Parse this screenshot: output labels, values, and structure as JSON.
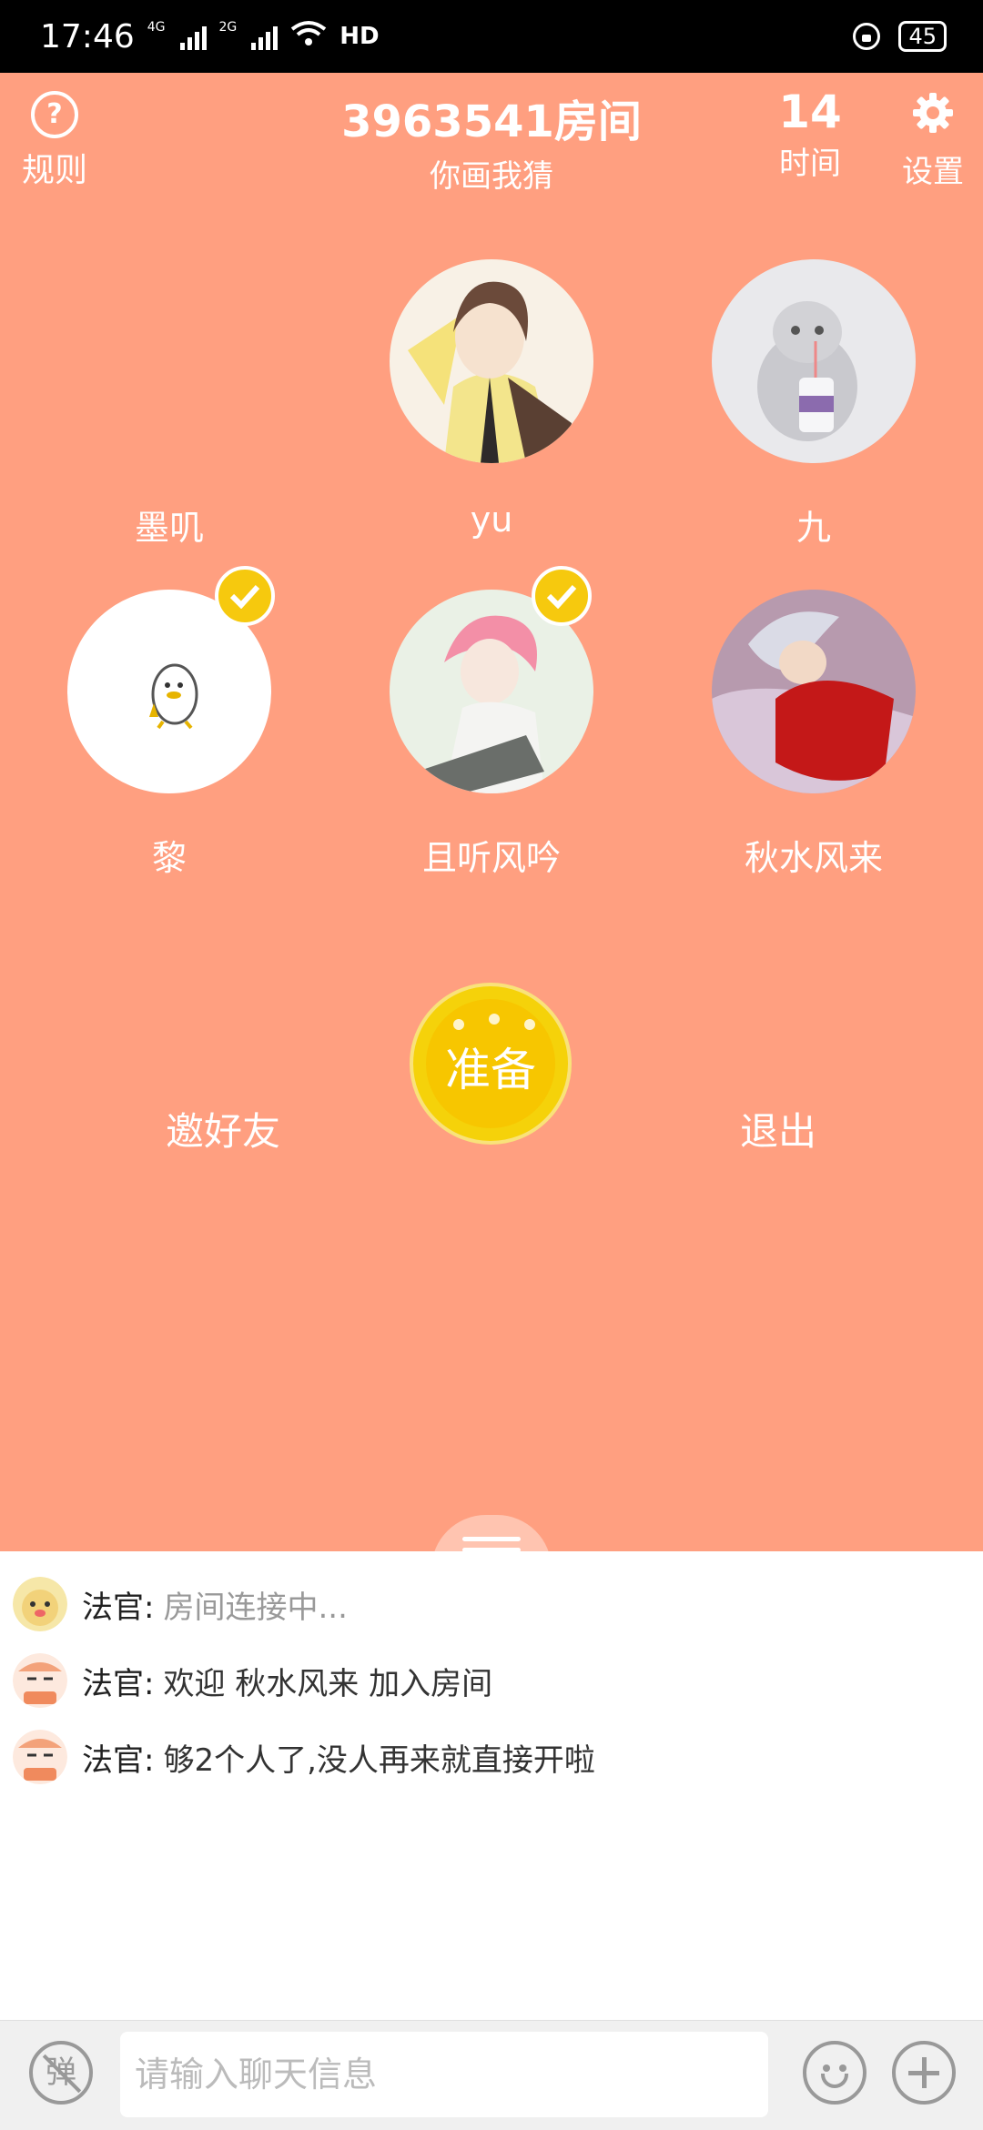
{
  "status_bar": {
    "time": "17:46",
    "net1": "4G",
    "net2": "2G",
    "hd": "HD",
    "battery": "45"
  },
  "header": {
    "rule_label": "规则",
    "room_title": "3963541房间",
    "room_subtitle": "你画我猜",
    "timer_value": "14",
    "timer_label": "时间",
    "settings_label": "设置"
  },
  "players": [
    {
      "name": "墨叽",
      "avatar": "empty",
      "ready": false
    },
    {
      "name": "yu",
      "avatar": "anime-boy",
      "ready": false
    },
    {
      "name": "九",
      "avatar": "cat",
      "ready": false
    },
    {
      "name": "黎",
      "avatar": "duck",
      "ready": true
    },
    {
      "name": "且听风吟",
      "avatar": "pink-hair",
      "ready": true
    },
    {
      "name": "秋水风来",
      "avatar": "inuyasha",
      "ready": false
    }
  ],
  "actions": {
    "invite": "邀好友",
    "ready": "准备",
    "quit": "退出"
  },
  "chat": {
    "messages": [
      {
        "speaker": "法官:",
        "text": "房间连接中...",
        "style": "status"
      },
      {
        "speaker": "法官:",
        "text": "欢迎 秋水风来 加入房间",
        "style": "normal"
      },
      {
        "speaker": "法官:",
        "text": "够2个人了,没人再来就直接开啦",
        "style": "normal"
      }
    ]
  },
  "input_bar": {
    "danmu_label": "弹",
    "placeholder": "请输入聊天信息"
  },
  "colors": {
    "bg": "#FF9F80",
    "ready_yellow": "#F7C600",
    "check_yellow": "#F6C90E"
  }
}
